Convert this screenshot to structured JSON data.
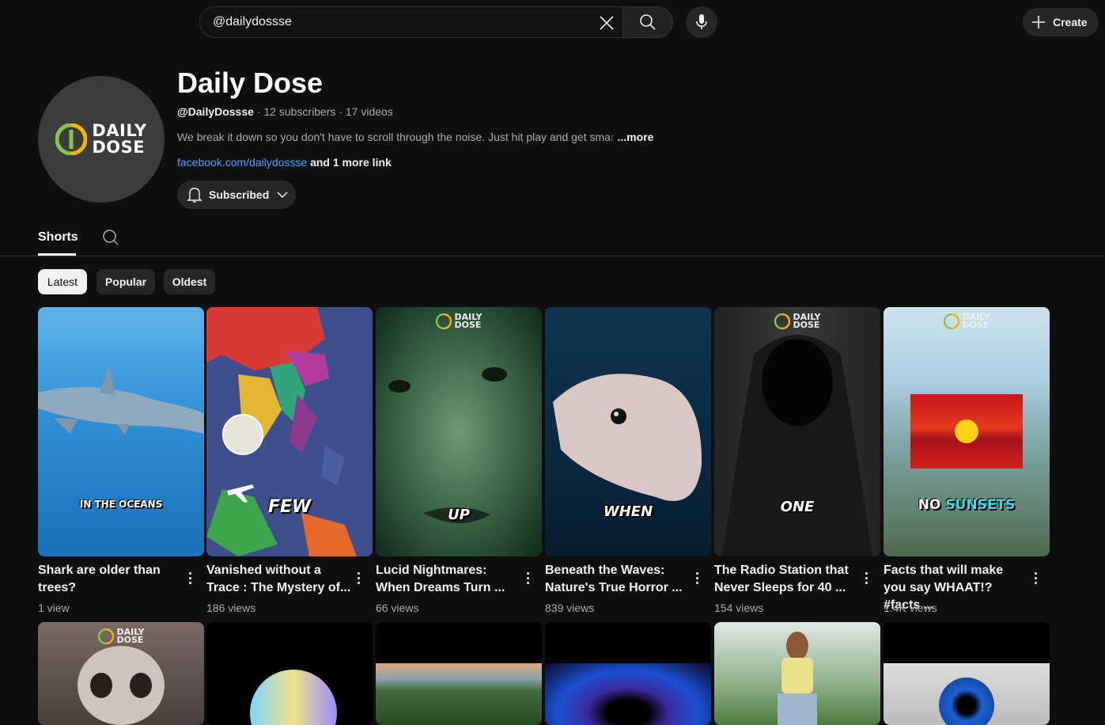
{
  "search": {
    "query": "@dailydossse"
  },
  "header": {
    "create_label": "Create"
  },
  "channel": {
    "avatar_line1": "DAILY",
    "avatar_line2": "DOSE",
    "name": "Daily Dose",
    "handle": "@DailyDossse",
    "subscribers": "12 subscribers",
    "videos": "17 videos",
    "separator": " · ",
    "description": "We break it down so you don't have to scroll through the noise. Just hit play and get sma",
    "description_fade": "r",
    "more_label": "...more",
    "link": "facebook.com/dailydossse",
    "more_links": "and 1 more link",
    "subscribe_label": "Subscribed"
  },
  "tabs": {
    "shorts": "Shorts"
  },
  "filters": [
    "Latest",
    "Popular",
    "Oldest"
  ],
  "watermark": {
    "line1": "DAILY",
    "line2": "DOSE"
  },
  "shorts": [
    {
      "caption": "IN THE OCEANS",
      "title": "Shark are older than trees?",
      "views": "1 view"
    },
    {
      "caption": "FEW",
      "title": "Vanished without a Trace : The Mystery of...",
      "views": "186 views"
    },
    {
      "caption": "UP",
      "title": "Lucid Nightmares: When Dreams Turn ...",
      "views": "66 views"
    },
    {
      "caption": "WHEN",
      "title": "Beneath the Waves: Nature's True Horror ...",
      "views": "839 views"
    },
    {
      "caption": "ONE",
      "title": "The Radio Station that Never Sleeps for 40 ...",
      "views": "154 views"
    },
    {
      "caption_a": "NO",
      "caption_b": "SUNSETS",
      "title": "Facts that will make you say WHAAT!? #facts ...",
      "views": "1.4K views"
    }
  ]
}
